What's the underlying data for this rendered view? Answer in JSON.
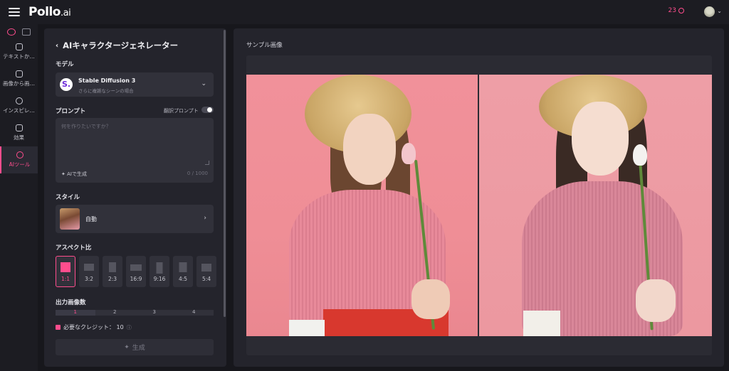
{
  "app": {
    "logo": "Pollo",
    "logo_suffix": ".ai",
    "credits": "23",
    "accent": "#ff4d8d"
  },
  "rail": {
    "items": [
      {
        "label": "テキストか…",
        "icon": "text-to-image-icon"
      },
      {
        "label": "画像から画…",
        "icon": "image-to-image-icon"
      },
      {
        "label": "インスピレ…",
        "icon": "compass-icon"
      },
      {
        "label": "効果",
        "icon": "effects-icon"
      },
      {
        "label": "AIツール",
        "icon": "ai-tools-icon",
        "active": true
      }
    ]
  },
  "panel": {
    "title": "AIキャラクタージェネレーター",
    "model_label": "モデル",
    "model_name": "Stable Diffusion 3",
    "model_desc": "さらに複雑なシーンの場合",
    "prompt_label": "プロンプト",
    "translate_label": "翻訳プロンプト",
    "prompt_placeholder": "何を作りたいですか？",
    "ai_generate": "AIで生成",
    "counter": "0 / 1000",
    "style_label": "スタイル",
    "style_name": "自動",
    "aspect_label": "アスペクト比",
    "aspects": [
      "1:1",
      "3:2",
      "2:3",
      "16:9",
      "9:16",
      "4:5",
      "5:4"
    ],
    "selected_aspect": "1:1",
    "count_label": "出力画像数",
    "counts": [
      "1",
      "2",
      "3",
      "4"
    ],
    "selected_count": "1",
    "credits_needed": "必要なクレジット：  10",
    "generate_button": "生成"
  },
  "main": {
    "title": "サンプル画像"
  }
}
